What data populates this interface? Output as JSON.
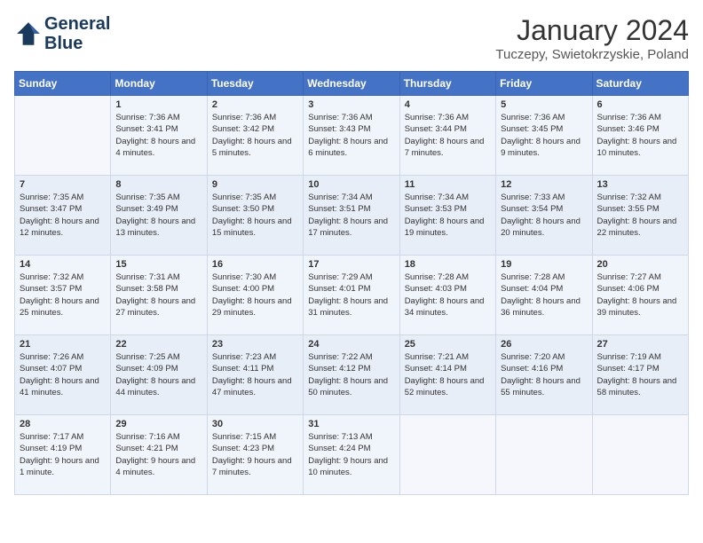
{
  "header": {
    "logo_line1": "General",
    "logo_line2": "Blue",
    "month": "January 2024",
    "location": "Tuczepy, Swietokrzyskie, Poland"
  },
  "weekdays": [
    "Sunday",
    "Monday",
    "Tuesday",
    "Wednesday",
    "Thursday",
    "Friday",
    "Saturday"
  ],
  "weeks": [
    [
      {
        "day": "",
        "sunrise": "",
        "sunset": "",
        "daylight": ""
      },
      {
        "day": "1",
        "sunrise": "Sunrise: 7:36 AM",
        "sunset": "Sunset: 3:41 PM",
        "daylight": "Daylight: 8 hours and 4 minutes."
      },
      {
        "day": "2",
        "sunrise": "Sunrise: 7:36 AM",
        "sunset": "Sunset: 3:42 PM",
        "daylight": "Daylight: 8 hours and 5 minutes."
      },
      {
        "day": "3",
        "sunrise": "Sunrise: 7:36 AM",
        "sunset": "Sunset: 3:43 PM",
        "daylight": "Daylight: 8 hours and 6 minutes."
      },
      {
        "day": "4",
        "sunrise": "Sunrise: 7:36 AM",
        "sunset": "Sunset: 3:44 PM",
        "daylight": "Daylight: 8 hours and 7 minutes."
      },
      {
        "day": "5",
        "sunrise": "Sunrise: 7:36 AM",
        "sunset": "Sunset: 3:45 PM",
        "daylight": "Daylight: 8 hours and 9 minutes."
      },
      {
        "day": "6",
        "sunrise": "Sunrise: 7:36 AM",
        "sunset": "Sunset: 3:46 PM",
        "daylight": "Daylight: 8 hours and 10 minutes."
      }
    ],
    [
      {
        "day": "7",
        "sunrise": "Sunrise: 7:35 AM",
        "sunset": "Sunset: 3:47 PM",
        "daylight": "Daylight: 8 hours and 12 minutes."
      },
      {
        "day": "8",
        "sunrise": "Sunrise: 7:35 AM",
        "sunset": "Sunset: 3:49 PM",
        "daylight": "Daylight: 8 hours and 13 minutes."
      },
      {
        "day": "9",
        "sunrise": "Sunrise: 7:35 AM",
        "sunset": "Sunset: 3:50 PM",
        "daylight": "Daylight: 8 hours and 15 minutes."
      },
      {
        "day": "10",
        "sunrise": "Sunrise: 7:34 AM",
        "sunset": "Sunset: 3:51 PM",
        "daylight": "Daylight: 8 hours and 17 minutes."
      },
      {
        "day": "11",
        "sunrise": "Sunrise: 7:34 AM",
        "sunset": "Sunset: 3:53 PM",
        "daylight": "Daylight: 8 hours and 19 minutes."
      },
      {
        "day": "12",
        "sunrise": "Sunrise: 7:33 AM",
        "sunset": "Sunset: 3:54 PM",
        "daylight": "Daylight: 8 hours and 20 minutes."
      },
      {
        "day": "13",
        "sunrise": "Sunrise: 7:32 AM",
        "sunset": "Sunset: 3:55 PM",
        "daylight": "Daylight: 8 hours and 22 minutes."
      }
    ],
    [
      {
        "day": "14",
        "sunrise": "Sunrise: 7:32 AM",
        "sunset": "Sunset: 3:57 PM",
        "daylight": "Daylight: 8 hours and 25 minutes."
      },
      {
        "day": "15",
        "sunrise": "Sunrise: 7:31 AM",
        "sunset": "Sunset: 3:58 PM",
        "daylight": "Daylight: 8 hours and 27 minutes."
      },
      {
        "day": "16",
        "sunrise": "Sunrise: 7:30 AM",
        "sunset": "Sunset: 4:00 PM",
        "daylight": "Daylight: 8 hours and 29 minutes."
      },
      {
        "day": "17",
        "sunrise": "Sunrise: 7:29 AM",
        "sunset": "Sunset: 4:01 PM",
        "daylight": "Daylight: 8 hours and 31 minutes."
      },
      {
        "day": "18",
        "sunrise": "Sunrise: 7:28 AM",
        "sunset": "Sunset: 4:03 PM",
        "daylight": "Daylight: 8 hours and 34 minutes."
      },
      {
        "day": "19",
        "sunrise": "Sunrise: 7:28 AM",
        "sunset": "Sunset: 4:04 PM",
        "daylight": "Daylight: 8 hours and 36 minutes."
      },
      {
        "day": "20",
        "sunrise": "Sunrise: 7:27 AM",
        "sunset": "Sunset: 4:06 PM",
        "daylight": "Daylight: 8 hours and 39 minutes."
      }
    ],
    [
      {
        "day": "21",
        "sunrise": "Sunrise: 7:26 AM",
        "sunset": "Sunset: 4:07 PM",
        "daylight": "Daylight: 8 hours and 41 minutes."
      },
      {
        "day": "22",
        "sunrise": "Sunrise: 7:25 AM",
        "sunset": "Sunset: 4:09 PM",
        "daylight": "Daylight: 8 hours and 44 minutes."
      },
      {
        "day": "23",
        "sunrise": "Sunrise: 7:23 AM",
        "sunset": "Sunset: 4:11 PM",
        "daylight": "Daylight: 8 hours and 47 minutes."
      },
      {
        "day": "24",
        "sunrise": "Sunrise: 7:22 AM",
        "sunset": "Sunset: 4:12 PM",
        "daylight": "Daylight: 8 hours and 50 minutes."
      },
      {
        "day": "25",
        "sunrise": "Sunrise: 7:21 AM",
        "sunset": "Sunset: 4:14 PM",
        "daylight": "Daylight: 8 hours and 52 minutes."
      },
      {
        "day": "26",
        "sunrise": "Sunrise: 7:20 AM",
        "sunset": "Sunset: 4:16 PM",
        "daylight": "Daylight: 8 hours and 55 minutes."
      },
      {
        "day": "27",
        "sunrise": "Sunrise: 7:19 AM",
        "sunset": "Sunset: 4:17 PM",
        "daylight": "Daylight: 8 hours and 58 minutes."
      }
    ],
    [
      {
        "day": "28",
        "sunrise": "Sunrise: 7:17 AM",
        "sunset": "Sunset: 4:19 PM",
        "daylight": "Daylight: 9 hours and 1 minute."
      },
      {
        "day": "29",
        "sunrise": "Sunrise: 7:16 AM",
        "sunset": "Sunset: 4:21 PM",
        "daylight": "Daylight: 9 hours and 4 minutes."
      },
      {
        "day": "30",
        "sunrise": "Sunrise: 7:15 AM",
        "sunset": "Sunset: 4:23 PM",
        "daylight": "Daylight: 9 hours and 7 minutes."
      },
      {
        "day": "31",
        "sunrise": "Sunrise: 7:13 AM",
        "sunset": "Sunset: 4:24 PM",
        "daylight": "Daylight: 9 hours and 10 minutes."
      },
      {
        "day": "",
        "sunrise": "",
        "sunset": "",
        "daylight": ""
      },
      {
        "day": "",
        "sunrise": "",
        "sunset": "",
        "daylight": ""
      },
      {
        "day": "",
        "sunrise": "",
        "sunset": "",
        "daylight": ""
      }
    ]
  ]
}
